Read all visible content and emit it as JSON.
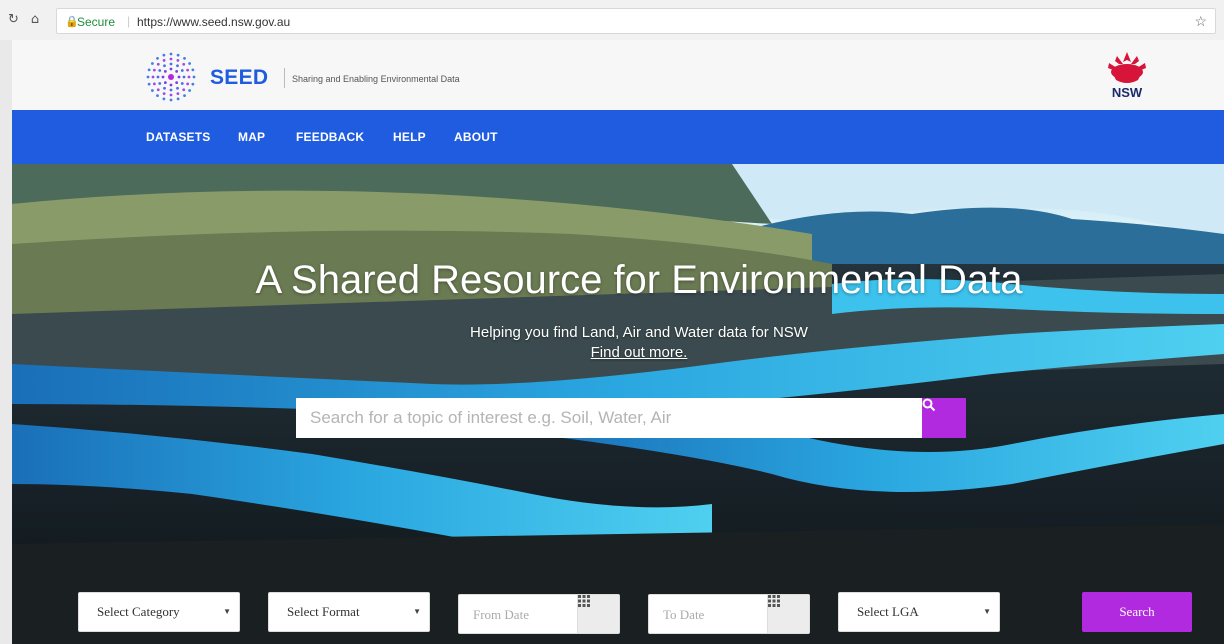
{
  "browser": {
    "secure_label": "Secure",
    "url": "https://www.seed.nsw.gov.au"
  },
  "header": {
    "logo_text": "SEED",
    "tagline": "Sharing and Enabling Environmental Data",
    "gov_logo_text": "NSW"
  },
  "nav": {
    "items": [
      "DATASETS",
      "MAP",
      "FEEDBACK",
      "HELP",
      "ABOUT"
    ]
  },
  "hero": {
    "title": "A Shared Resource for Environmental Data",
    "subtitle": "Helping you find Land, Air and Water data for NSW",
    "link_text": "Find out more.",
    "search_placeholder": "Search for a topic of interest e.g. Soil, Water, Air"
  },
  "filters": {
    "category": "Select Category",
    "format": "Select Format",
    "from_date_placeholder": "From Date",
    "to_date_placeholder": "To Date",
    "lga": "Select LGA",
    "search_label": "Search"
  },
  "colors": {
    "brand_blue": "#1f5ce0",
    "accent_purple": "#b12ae0",
    "nsw_red": "#d7153a"
  }
}
